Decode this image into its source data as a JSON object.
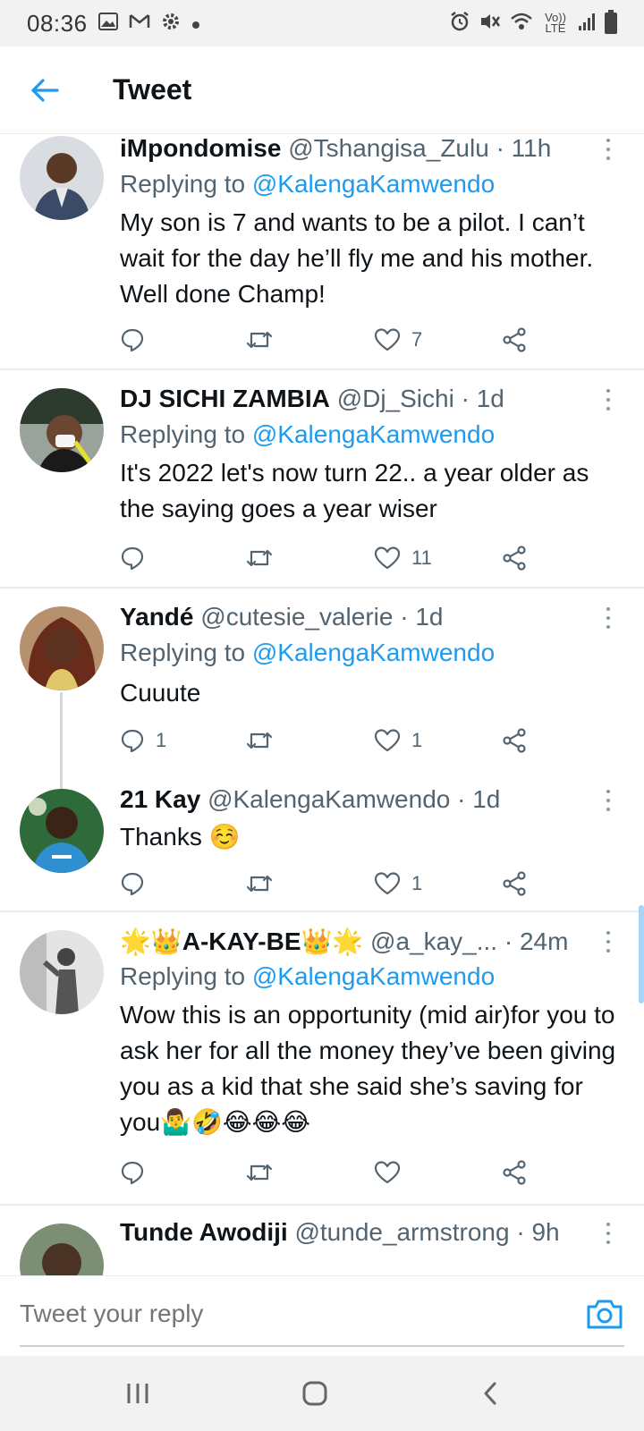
{
  "status_bar": {
    "time": "08:36",
    "network": "Vo)) LTE"
  },
  "header": {
    "title": "Tweet"
  },
  "tweets": [
    {
      "name": "iMpondomise",
      "handle": "@Tshangisa_Zulu",
      "time": "· 11h",
      "replying_label": "Replying to ",
      "replying_to": "@KalengaKamwendo",
      "text": "My son is 7 and wants to be a pilot. I can’t wait for the day he’ll fly me and his mother. Well done Champ!",
      "reply_count": "",
      "retweet_count": "",
      "like_count": "7"
    },
    {
      "name": "DJ SICHI ZAMBIA",
      "handle": "@Dj_Sichi",
      "time": "· 1d",
      "replying_label": "Replying to ",
      "replying_to": "@KalengaKamwendo",
      "text": "It's 2022 let's now turn 22..  a year older as the saying goes a year wiser",
      "reply_count": "",
      "retweet_count": "",
      "like_count": "11"
    },
    {
      "name": "Yandé",
      "handle": "@cutesie_valerie",
      "time": "· 1d",
      "replying_label": "Replying to ",
      "replying_to": "@KalengaKamwendo",
      "text": "Cuuute",
      "reply_count": "1",
      "retweet_count": "",
      "like_count": "1"
    },
    {
      "name": "21 Kay",
      "handle": "@KalengaKamwendo",
      "time": "· 1d",
      "text": "Thanks ☺️",
      "reply_count": "",
      "retweet_count": "",
      "like_count": "1"
    },
    {
      "name": "🌟👑A-KAY-BE👑🌟",
      "handle": "@a_kay_...",
      "time": "· 24m",
      "replying_label": "Replying to ",
      "replying_to": "@KalengaKamwendo",
      "text": "Wow this is an opportunity (mid air)for you to ask her for all the money they’ve been giving you as a kid that she said she’s saving for you🤷‍♂️🤣😂😂😂",
      "reply_count": "",
      "retweet_count": "",
      "like_count": ""
    },
    {
      "name": "Tunde Awodiji",
      "handle": "@tunde_armstrong",
      "time": "· 9h"
    }
  ],
  "reply_bar": {
    "placeholder": "Tweet your reply"
  },
  "colors": {
    "accent": "#1d9bf0",
    "muted": "#536471",
    "text": "#0f1419",
    "divider": "#e6ecf0"
  },
  "icons": {
    "back": "arrow-left-icon",
    "more": "more-vertical-icon",
    "reply": "comment-icon",
    "retweet": "retweet-icon",
    "like": "heart-icon",
    "share": "share-icon",
    "camera": "camera-icon"
  }
}
